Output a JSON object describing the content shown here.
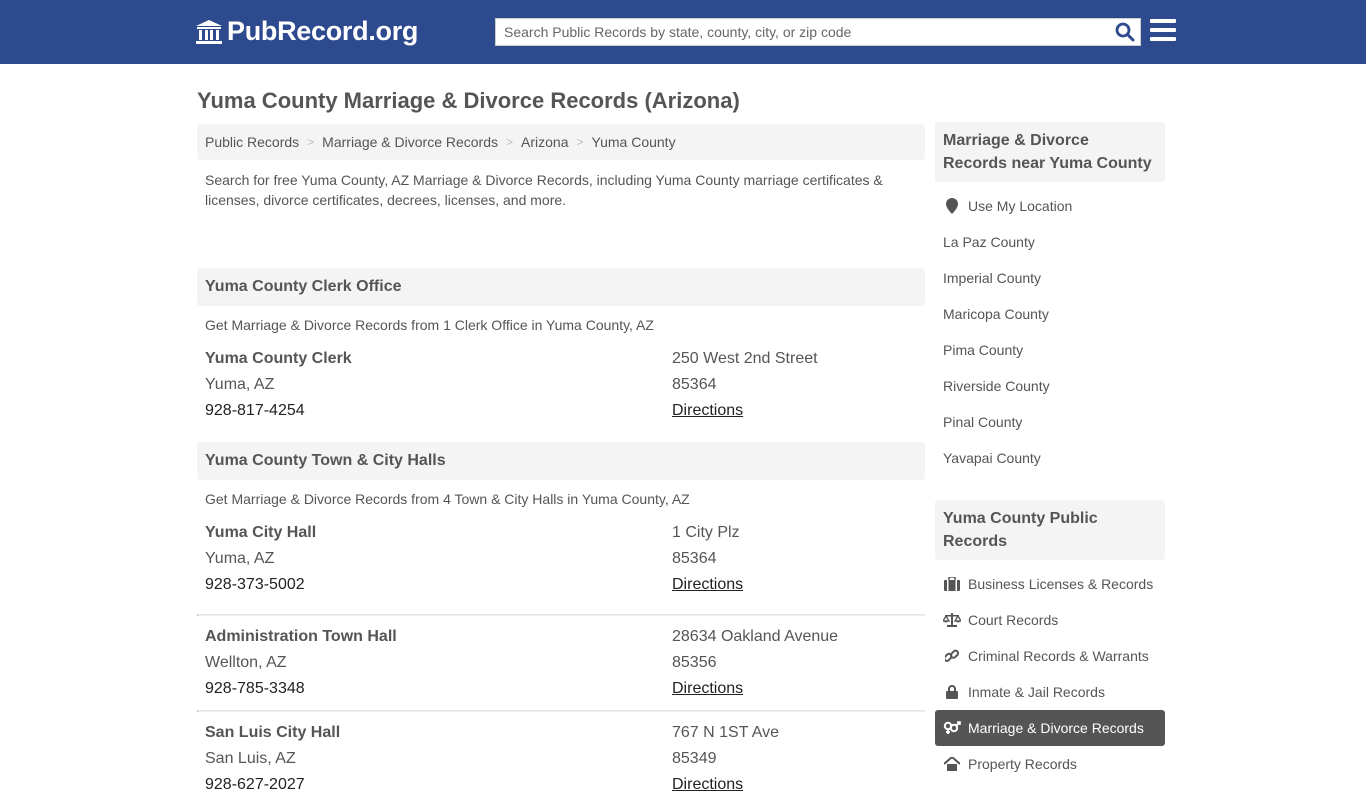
{
  "header": {
    "logo_text": "PubRecord.org",
    "search_placeholder": "Search Public Records by state, county, city, or zip code"
  },
  "page_title": "Yuma County Marriage & Divorce Records (Arizona)",
  "breadcrumb": [
    "Public Records",
    "Marriage & Divorce Records",
    "Arizona",
    "Yuma County"
  ],
  "intro": "Search for free Yuma County, AZ Marriage & Divorce Records, including Yuma County marriage certificates & licenses, divorce certificates, decrees, licenses, and more.",
  "sections": [
    {
      "title": "Yuma County Clerk Office",
      "subtitle": "Get Marriage & Divorce Records from 1 Clerk Office in Yuma County, AZ",
      "entries": [
        {
          "name": "Yuma County Clerk",
          "city": "Yuma, AZ",
          "phone": "928-817-4254",
          "address": "250 West 2nd Street",
          "zip": "85364",
          "directions": "Directions"
        }
      ]
    },
    {
      "title": "Yuma County Town & City Halls",
      "subtitle": "Get Marriage & Divorce Records from 4 Town & City Halls in Yuma County, AZ",
      "entries": [
        {
          "name": "Yuma City Hall",
          "city": "Yuma, AZ",
          "phone": "928-373-5002",
          "address": "1 City Plz",
          "zip": "85364",
          "directions": "Directions"
        },
        {
          "name": "Administration Town Hall",
          "city": "Wellton, AZ",
          "phone": "928-785-3348",
          "address": "28634 Oakland Avenue",
          "zip": "85356",
          "directions": "Directions"
        },
        {
          "name": "San Luis City Hall",
          "city": "San Luis, AZ",
          "phone": "928-627-2027",
          "address": "767 N 1ST Ave",
          "zip": "85349",
          "directions": "Directions"
        }
      ]
    }
  ],
  "sidebar": {
    "nearby_title": "Marriage & Divorce Records near Yuma County",
    "use_location": "Use My Location",
    "nearby": [
      "La Paz County",
      "Imperial County",
      "Maricopa County",
      "Pima County",
      "Riverside County",
      "Pinal County",
      "Yavapai County"
    ],
    "public_title": "Yuma County Public Records",
    "public": [
      {
        "label": "Business Licenses & Records",
        "icon": "briefcase-icon"
      },
      {
        "label": "Court Records",
        "icon": "scale-icon"
      },
      {
        "label": "Criminal Records & Warrants",
        "icon": "link-icon"
      },
      {
        "label": "Inmate & Jail Records",
        "icon": "lock-icon"
      },
      {
        "label": "Marriage & Divorce Records",
        "icon": "venus-mars-icon",
        "active": true
      },
      {
        "label": "Property Records",
        "icon": "home-icon"
      }
    ]
  }
}
